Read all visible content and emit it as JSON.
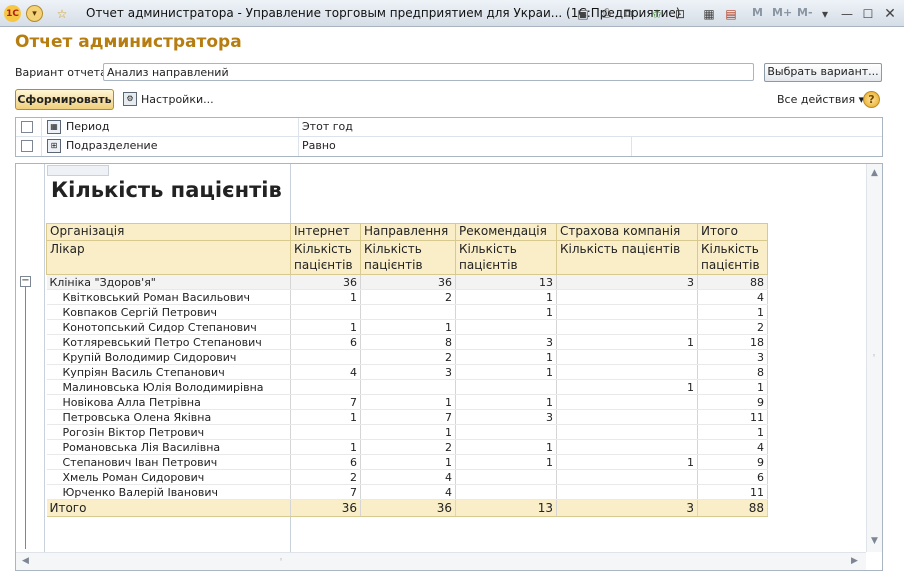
{
  "window": {
    "title": "Отчет администратора - Управление торговым предприятием для Украи...  (1С:Предприятие)",
    "app_icon": "1С",
    "toolbar_m_labels": [
      "M",
      "M+",
      "M-"
    ]
  },
  "header": {
    "page_title": "Отчет администратора",
    "variant_label": "Вариант отчета:",
    "variant_value": "Анализ направлений",
    "choose_variant": "Выбрать вариант...",
    "generate": "Сформировать",
    "settings": "Настройки...",
    "all_actions": "Все действия",
    "help": "?"
  },
  "filters": [
    {
      "name": "Период",
      "value": "Этот год"
    },
    {
      "name": "Подразделение",
      "value": "Равно"
    }
  ],
  "report": {
    "title": "Кількість пацієнтів",
    "header_row1": [
      "Організація",
      "Інтернет",
      "Направлення",
      "Рекомендація",
      "Страхова компанія",
      "Итого"
    ],
    "header_row2": [
      "Лікар",
      "Кількість пацієнтів",
      "Кількість пацієнтів",
      "Кількість пацієнтів",
      "Кількість пацієнтів",
      "Кількість пацієнтів"
    ],
    "group": {
      "name": "Клініка \"Здоров'я\"",
      "values": [
        "36",
        "36",
        "13",
        "3",
        "88"
      ]
    },
    "rows": [
      {
        "name": "Квітковський Роман Васильович",
        "values": [
          "1",
          "2",
          "1",
          "",
          "4"
        ]
      },
      {
        "name": "Ковпаков Сергій Петрович",
        "values": [
          "",
          "",
          "1",
          "",
          "1"
        ]
      },
      {
        "name": "Конотопський Сидор Степанович",
        "values": [
          "1",
          "1",
          "",
          "",
          "2"
        ]
      },
      {
        "name": "Котляревський Петро Степанович",
        "values": [
          "6",
          "8",
          "3",
          "1",
          "18"
        ]
      },
      {
        "name": "Крупій Володимир Сидорович",
        "values": [
          "",
          "2",
          "1",
          "",
          "3"
        ]
      },
      {
        "name": "Купріян Василь Степанович",
        "values": [
          "4",
          "3",
          "1",
          "",
          "8"
        ]
      },
      {
        "name": "Малиновська Юлія Володимирівна",
        "values": [
          "",
          "",
          "",
          "1",
          "1"
        ]
      },
      {
        "name": "Новікова Алла Петрівна",
        "values": [
          "7",
          "1",
          "1",
          "",
          "9"
        ]
      },
      {
        "name": "Петровська Олена Яківна",
        "values": [
          "1",
          "7",
          "3",
          "",
          "11"
        ]
      },
      {
        "name": "Рогозін Віктор Петрович",
        "values": [
          "",
          "1",
          "",
          "",
          "1"
        ]
      },
      {
        "name": "Романовська Лія Василівна",
        "values": [
          "1",
          "2",
          "1",
          "",
          "4"
        ]
      },
      {
        "name": "Степанович Іван Петрович",
        "values": [
          "6",
          "1",
          "1",
          "1",
          "9"
        ]
      },
      {
        "name": "Хмель Роман Сидорович",
        "values": [
          "2",
          "4",
          "",
          "",
          "6"
        ]
      },
      {
        "name": "Юрченко Валерій Іванович",
        "values": [
          "7",
          "4",
          "",
          "",
          "11"
        ]
      }
    ],
    "total": {
      "name": "Итого",
      "values": [
        "36",
        "36",
        "13",
        "3",
        "88"
      ]
    }
  }
}
